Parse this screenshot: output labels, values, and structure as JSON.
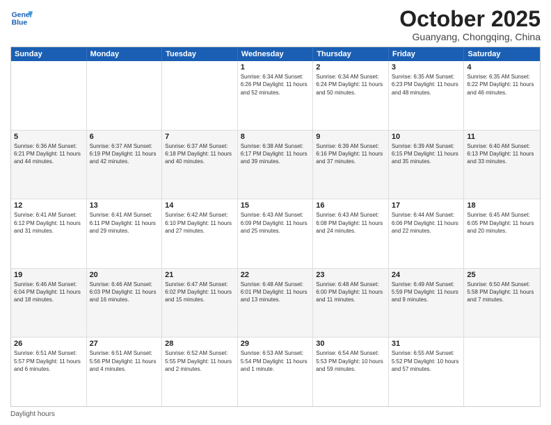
{
  "header": {
    "logo_line1": "General",
    "logo_line2": "Blue",
    "title": "October 2025",
    "subtitle": "Guanyang, Chongqing, China"
  },
  "days": [
    "Sunday",
    "Monday",
    "Tuesday",
    "Wednesday",
    "Thursday",
    "Friday",
    "Saturday"
  ],
  "footer_label": "Daylight hours",
  "rows": [
    [
      {
        "num": "",
        "info": ""
      },
      {
        "num": "",
        "info": ""
      },
      {
        "num": "",
        "info": ""
      },
      {
        "num": "1",
        "info": "Sunrise: 6:34 AM\nSunset: 6:26 PM\nDaylight: 11 hours\nand 52 minutes."
      },
      {
        "num": "2",
        "info": "Sunrise: 6:34 AM\nSunset: 6:24 PM\nDaylight: 11 hours\nand 50 minutes."
      },
      {
        "num": "3",
        "info": "Sunrise: 6:35 AM\nSunset: 6:23 PM\nDaylight: 11 hours\nand 48 minutes."
      },
      {
        "num": "4",
        "info": "Sunrise: 6:35 AM\nSunset: 6:22 PM\nDaylight: 11 hours\nand 46 minutes."
      }
    ],
    [
      {
        "num": "5",
        "info": "Sunrise: 6:36 AM\nSunset: 6:21 PM\nDaylight: 11 hours\nand 44 minutes."
      },
      {
        "num": "6",
        "info": "Sunrise: 6:37 AM\nSunset: 6:19 PM\nDaylight: 11 hours\nand 42 minutes."
      },
      {
        "num": "7",
        "info": "Sunrise: 6:37 AM\nSunset: 6:18 PM\nDaylight: 11 hours\nand 40 minutes."
      },
      {
        "num": "8",
        "info": "Sunrise: 6:38 AM\nSunset: 6:17 PM\nDaylight: 11 hours\nand 39 minutes."
      },
      {
        "num": "9",
        "info": "Sunrise: 6:39 AM\nSunset: 6:16 PM\nDaylight: 11 hours\nand 37 minutes."
      },
      {
        "num": "10",
        "info": "Sunrise: 6:39 AM\nSunset: 6:15 PM\nDaylight: 11 hours\nand 35 minutes."
      },
      {
        "num": "11",
        "info": "Sunrise: 6:40 AM\nSunset: 6:13 PM\nDaylight: 11 hours\nand 33 minutes."
      }
    ],
    [
      {
        "num": "12",
        "info": "Sunrise: 6:41 AM\nSunset: 6:12 PM\nDaylight: 11 hours\nand 31 minutes."
      },
      {
        "num": "13",
        "info": "Sunrise: 6:41 AM\nSunset: 6:11 PM\nDaylight: 11 hours\nand 29 minutes."
      },
      {
        "num": "14",
        "info": "Sunrise: 6:42 AM\nSunset: 6:10 PM\nDaylight: 11 hours\nand 27 minutes."
      },
      {
        "num": "15",
        "info": "Sunrise: 6:43 AM\nSunset: 6:09 PM\nDaylight: 11 hours\nand 25 minutes."
      },
      {
        "num": "16",
        "info": "Sunrise: 6:43 AM\nSunset: 6:08 PM\nDaylight: 11 hours\nand 24 minutes."
      },
      {
        "num": "17",
        "info": "Sunrise: 6:44 AM\nSunset: 6:06 PM\nDaylight: 11 hours\nand 22 minutes."
      },
      {
        "num": "18",
        "info": "Sunrise: 6:45 AM\nSunset: 6:05 PM\nDaylight: 11 hours\nand 20 minutes."
      }
    ],
    [
      {
        "num": "19",
        "info": "Sunrise: 6:46 AM\nSunset: 6:04 PM\nDaylight: 11 hours\nand 18 minutes."
      },
      {
        "num": "20",
        "info": "Sunrise: 6:46 AM\nSunset: 6:03 PM\nDaylight: 11 hours\nand 16 minutes."
      },
      {
        "num": "21",
        "info": "Sunrise: 6:47 AM\nSunset: 6:02 PM\nDaylight: 11 hours\nand 15 minutes."
      },
      {
        "num": "22",
        "info": "Sunrise: 6:48 AM\nSunset: 6:01 PM\nDaylight: 11 hours\nand 13 minutes."
      },
      {
        "num": "23",
        "info": "Sunrise: 6:48 AM\nSunset: 6:00 PM\nDaylight: 11 hours\nand 11 minutes."
      },
      {
        "num": "24",
        "info": "Sunrise: 6:49 AM\nSunset: 5:59 PM\nDaylight: 11 hours\nand 9 minutes."
      },
      {
        "num": "25",
        "info": "Sunrise: 6:50 AM\nSunset: 5:58 PM\nDaylight: 11 hours\nand 7 minutes."
      }
    ],
    [
      {
        "num": "26",
        "info": "Sunrise: 6:51 AM\nSunset: 5:57 PM\nDaylight: 11 hours\nand 6 minutes."
      },
      {
        "num": "27",
        "info": "Sunrise: 6:51 AM\nSunset: 5:56 PM\nDaylight: 11 hours\nand 4 minutes."
      },
      {
        "num": "28",
        "info": "Sunrise: 6:52 AM\nSunset: 5:55 PM\nDaylight: 11 hours\nand 2 minutes."
      },
      {
        "num": "29",
        "info": "Sunrise: 6:53 AM\nSunset: 5:54 PM\nDaylight: 11 hours\nand 1 minute."
      },
      {
        "num": "30",
        "info": "Sunrise: 6:54 AM\nSunset: 5:53 PM\nDaylight: 10 hours\nand 59 minutes."
      },
      {
        "num": "31",
        "info": "Sunrise: 6:55 AM\nSunset: 5:52 PM\nDaylight: 10 hours\nand 57 minutes."
      },
      {
        "num": "",
        "info": ""
      }
    ]
  ]
}
